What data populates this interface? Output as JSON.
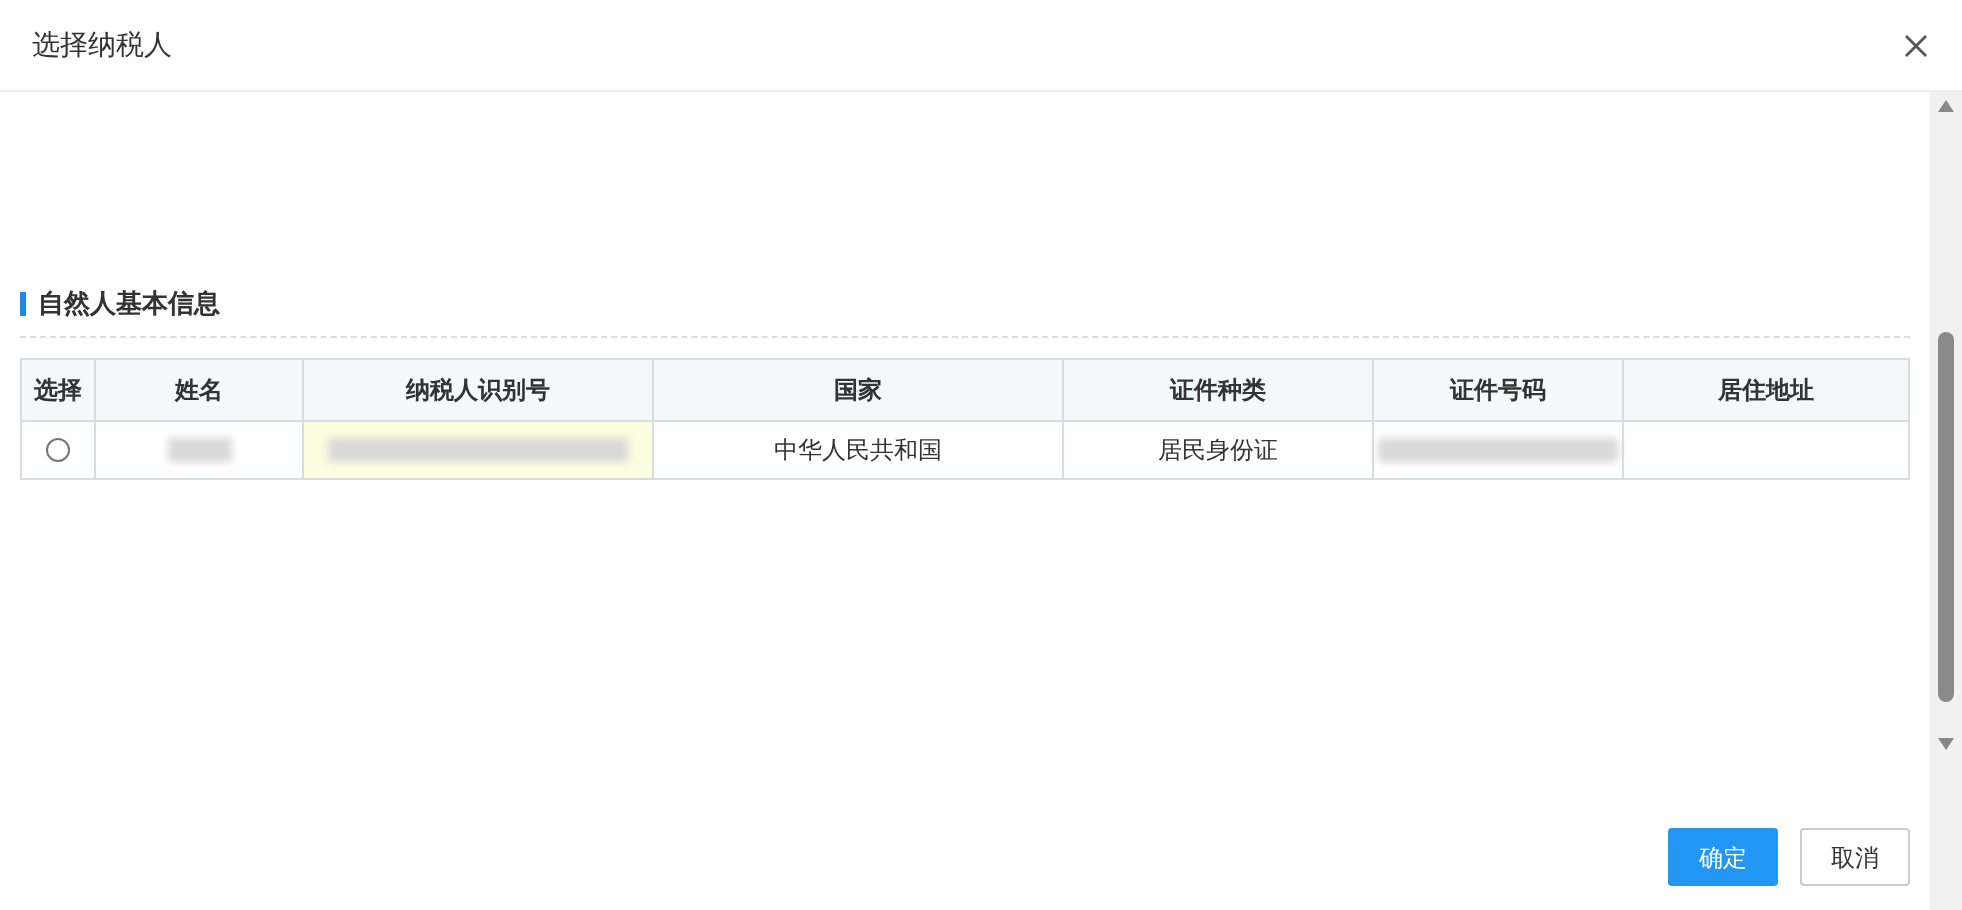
{
  "dialog": {
    "title": "选择纳税人"
  },
  "section": {
    "title": "自然人基本信息"
  },
  "table": {
    "columns": [
      "选择",
      "姓名",
      "纳税人识别号",
      "国家",
      "证件种类",
      "证件号码",
      "居住地址"
    ],
    "rows": [
      {
        "selected": false,
        "cells": [
          {
            "kind": "radio"
          },
          {
            "kind": "blurred",
            "highlighted": false
          },
          {
            "kind": "blurred",
            "highlighted": true
          },
          {
            "kind": "text",
            "text": "中华人民共和国"
          },
          {
            "kind": "text",
            "text": "居民身份证"
          },
          {
            "kind": "blurred",
            "highlighted": false
          },
          {
            "kind": "empty"
          }
        ]
      }
    ]
  },
  "buttons": [
    {
      "label": "确定",
      "kind": "primary"
    },
    {
      "label": "取消",
      "kind": "secondary"
    }
  ]
}
